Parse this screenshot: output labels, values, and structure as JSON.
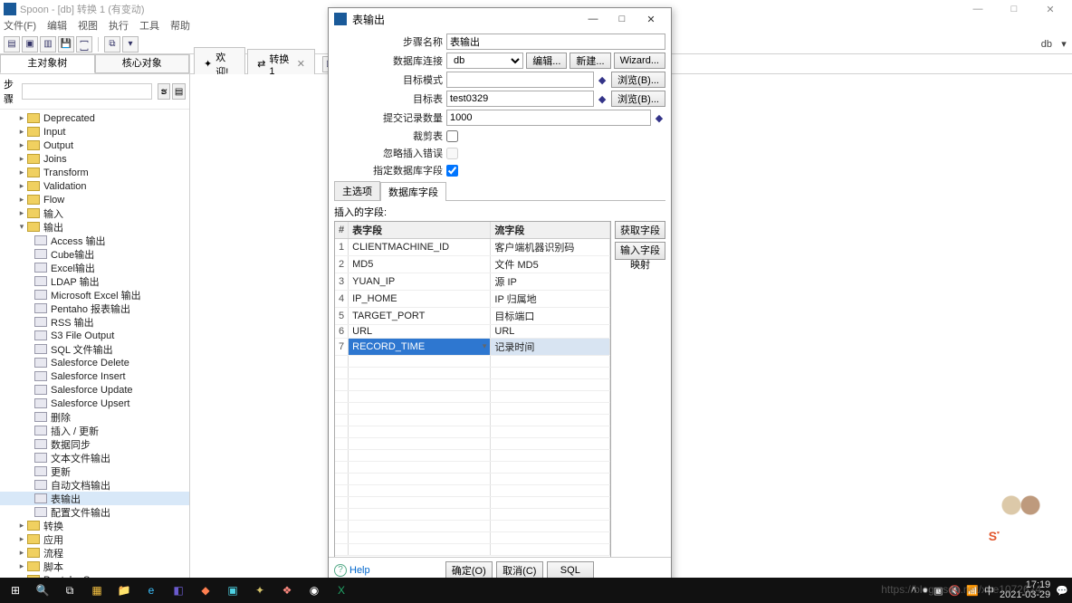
{
  "window": {
    "title": "Spoon - [db] 转换 1 (有变动)",
    "minimize": "—",
    "maximize": "□",
    "close": "✕"
  },
  "menu": [
    "文件(F)",
    "编辑",
    "视图",
    "执行",
    "工具",
    "帮助"
  ],
  "toolbar_right": {
    "db_label": "db",
    "dropdown": "▾"
  },
  "left_panel": {
    "tabs": [
      "主对象树",
      "核心对象"
    ],
    "step_label": "步骤",
    "search_placeholder": "",
    "tree": {
      "top": [
        {
          "label": "Deprecated",
          "exp": false
        },
        {
          "label": "Input",
          "exp": false
        },
        {
          "label": "Output",
          "exp": false
        },
        {
          "label": "Joins",
          "exp": false
        },
        {
          "label": "Transform",
          "exp": false
        },
        {
          "label": "Validation",
          "exp": false
        },
        {
          "label": "Flow",
          "exp": false
        },
        {
          "label": "输入",
          "exp": false
        }
      ],
      "output_label": "输出",
      "output_children": [
        "Access 输出",
        "Cube输出",
        "Excel输出",
        "LDAP 输出",
        "Microsoft Excel 输出",
        "Pentaho 报表输出",
        "RSS 输出",
        "S3 File Output",
        "SQL 文件输出",
        "Salesforce Delete",
        "Salesforce Insert",
        "Salesforce Update",
        "Salesforce Upsert",
        "删除",
        "插入 / 更新",
        "数据同步",
        "文本文件输出",
        "更新",
        "自动文档输出",
        "表输出",
        "配置文件输出"
      ],
      "bottom": [
        {
          "label": "转换"
        },
        {
          "label": "应用"
        },
        {
          "label": "流程"
        },
        {
          "label": "脚本"
        },
        {
          "label": "Pentaho Server"
        }
      ]
    }
  },
  "editor_tabs": [
    {
      "label": "欢迎!",
      "icon": "✦"
    },
    {
      "label": "转换 1",
      "icon": "⇄",
      "closable": true
    }
  ],
  "dialog": {
    "title": "表输出",
    "form": {
      "step_name_label": "步骤名称",
      "step_name_value": "表输出",
      "conn_label": "数据库连接",
      "conn_value": "db",
      "conn_edit": "编辑...",
      "conn_new": "新建...",
      "conn_wizard": "Wizard...",
      "schema_label": "目标模式",
      "schema_value": "",
      "schema_browse": "浏览(B)...",
      "table_label": "目标表",
      "table_value": "test0329",
      "table_browse": "浏览(B)...",
      "commit_label": "提交记录数量",
      "commit_value": "1000",
      "truncate_label": "裁剪表",
      "truncate_checked": false,
      "ignore_err_label": "忽略插入错误",
      "spec_fields_label": "指定数据库字段",
      "spec_fields_checked": true
    },
    "tabs": [
      "主选项",
      "数据库字段"
    ],
    "insert_label": "插入的字段:",
    "grid_headers": {
      "idx": "#",
      "col1": "表字段",
      "col2": "流字段"
    },
    "grid_rows": [
      {
        "n": "1",
        "a": "CLIENTMACHINE_ID",
        "b": "客户端机器识别码"
      },
      {
        "n": "2",
        "a": "MD5",
        "b": "文件 MD5"
      },
      {
        "n": "3",
        "a": "YUAN_IP",
        "b": "源 IP"
      },
      {
        "n": "4",
        "a": "IP_HOME",
        "b": "IP 归属地"
      },
      {
        "n": "5",
        "a": "TARGET_PORT",
        "b": "目标端口"
      },
      {
        "n": "6",
        "a": "URL",
        "b": "URL"
      },
      {
        "n": "7",
        "a": "RECORD_TIME",
        "b": "记录时间"
      }
    ],
    "side_buttons": [
      "获取字段",
      "输入字段映射"
    ],
    "footer": {
      "help": "Help",
      "ok": "确定(O)",
      "cancel": "取消(C)",
      "sql": "SQL"
    }
  },
  "taskbar": {
    "time": "17:19",
    "date": "2021-03-29"
  },
  "watermark": "https://blog.csdn.net/xue1072624..."
}
